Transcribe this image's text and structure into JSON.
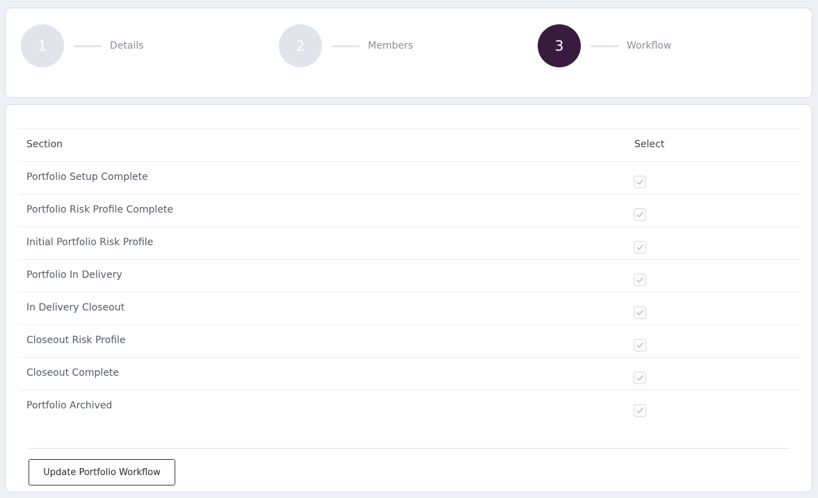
{
  "stepper": {
    "steps": [
      {
        "number": "1",
        "label": "Details",
        "state": "inactive"
      },
      {
        "number": "2",
        "label": "Members",
        "state": "inactive"
      },
      {
        "number": "3",
        "label": "Workflow",
        "state": "active"
      }
    ]
  },
  "table": {
    "headers": {
      "section": "Section",
      "select": "Select"
    },
    "rows": [
      {
        "section": "Portfolio Setup Complete",
        "checked": true
      },
      {
        "section": "Portfolio Risk Profile Complete",
        "checked": true
      },
      {
        "section": "Initial Portfolio Risk Profile",
        "checked": true
      },
      {
        "section": "Portfolio In Delivery",
        "checked": true
      },
      {
        "section": "In Delivery Closeout",
        "checked": true
      },
      {
        "section": "Closeout Risk Profile",
        "checked": true
      },
      {
        "section": "Closeout Complete",
        "checked": true
      },
      {
        "section": "Portfolio Archived",
        "checked": true
      }
    ]
  },
  "actions": {
    "update_label": "Update Portfolio Workflow"
  },
  "colors": {
    "active_step": "#3a1b3f",
    "inactive_step": "#e1e4ea",
    "background": "#eef0f5"
  }
}
